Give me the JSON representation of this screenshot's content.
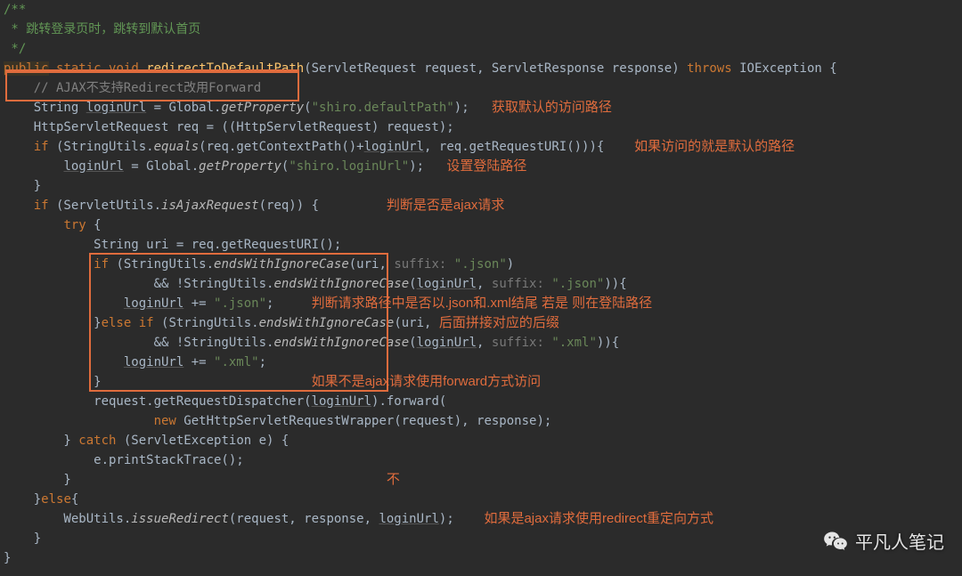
{
  "doc": {
    "open": "/**",
    "line1": " * 跳转登录页时，跳转到默认首页",
    "close": " */"
  },
  "sig": {
    "public": "public",
    "static": "static",
    "void": "void",
    "method": "redirectToDefaultPath",
    "params": "(ServletRequest request, ServletResponse response)",
    "throws": "throws",
    "exc": "IOException {"
  },
  "l": {
    "ajaxComment": "    // AJAX不支持Redirect改用Forward",
    "loginUrlDecl_a": "    String ",
    "loginUrlDecl_b": "loginUrl",
    "loginUrlDecl_c": " = Global.",
    "getProperty": "getProperty",
    "defaultPathStr": "\"shiro.defaultPath\"",
    "afterDefault": ");",
    "reqDecl": "    HttpServletRequest req = ((HttpServletRequest) request);",
    "if1_a": "    ",
    "if1_kw": "if",
    "if1_b": " (StringUtils.",
    "equals": "equals",
    "if1_c": "(req.getContextPath()+",
    "if1_d": ", req.getRequestURI())){",
    "setLogin_a": "        ",
    "setLogin_b": " = Global.",
    "loginUrlStr": "\"shiro.loginUrl\"",
    "setLogin_c": ");",
    "brace1": "    }",
    "if2_a": "    ",
    "if2_kw": "if",
    "if2_b": " (ServletUtils.",
    "isAjax": "isAjaxRequest",
    "if2_c": "(req)) {",
    "try_a": "        ",
    "try_kw": "try",
    "try_b": " {",
    "uriDecl": "            String uri = req.getRequestURI();",
    "innerIf_a": "            ",
    "innerIf_kw": "if",
    "innerIf_b": " (StringUtils.",
    "endsWithIC": "endsWithIgnoreCase",
    "innerIf_c": "(uri, ",
    "hintSuffix": "suffix: ",
    "jsonStr": "\".json\"",
    "innerIf_d": ")",
    "and_a": "                    && !StringUtils.",
    "and_b": "(",
    "and_c": ", ",
    "and_d": ")){",
    "addJson_a": "                ",
    "addJson_b": " += ",
    "addJson_c": ";",
    "else_a": "            }",
    "else_kw": "else if",
    "else_b": " (StringUtils.",
    "else_c": "(uri, ",
    "xmlStr": "\".xml\"",
    "else_d": ")",
    "addXml_a": "                ",
    "innerClose": "            }",
    "dispatch_a": "            request.getRequestDispatcher(",
    "dispatch_b": ").forward(",
    "new_a": "                    ",
    "new_kw": "new",
    "new_b": " GetHttpServletRequestWrapper(request), response);",
    "catch_a": "        } ",
    "catch_kw": "catch",
    "catch_b": " (ServletException e) {",
    "printStack": "            e.printStackTrace();",
    "catchClose": "        }",
    "elseOuter_a": "    }",
    "elseOuter_kw": "else",
    "elseOuter_b": "{",
    "webUtils_a": "        WebUtils.",
    "issueRedirect": "issueRedirect",
    "webUtils_b": "(request, response, ",
    "webUtils_c": ");",
    "elseClose": "    }",
    "methodClose": "}"
  },
  "ann": {
    "getDefault": "获取默认的访问路径",
    "ifDefault": "如果访问的就是默认的路径",
    "setLoginPath": "设置登陆路径",
    "judgeAjax": "判断是否是ajax请求",
    "suffixL1": "判断请求路径中是否以.json和.xml结尾 若是 则在登陆路径",
    "suffixL2": "后面拼接对应的后缀",
    "notAjaxFwd": "如果不是ajax请求使用forward方式访问",
    "buChar": "不",
    "redirectNote": "如果是ajax请求使用redirect重定向方式"
  },
  "watermark": "平凡人笔记"
}
